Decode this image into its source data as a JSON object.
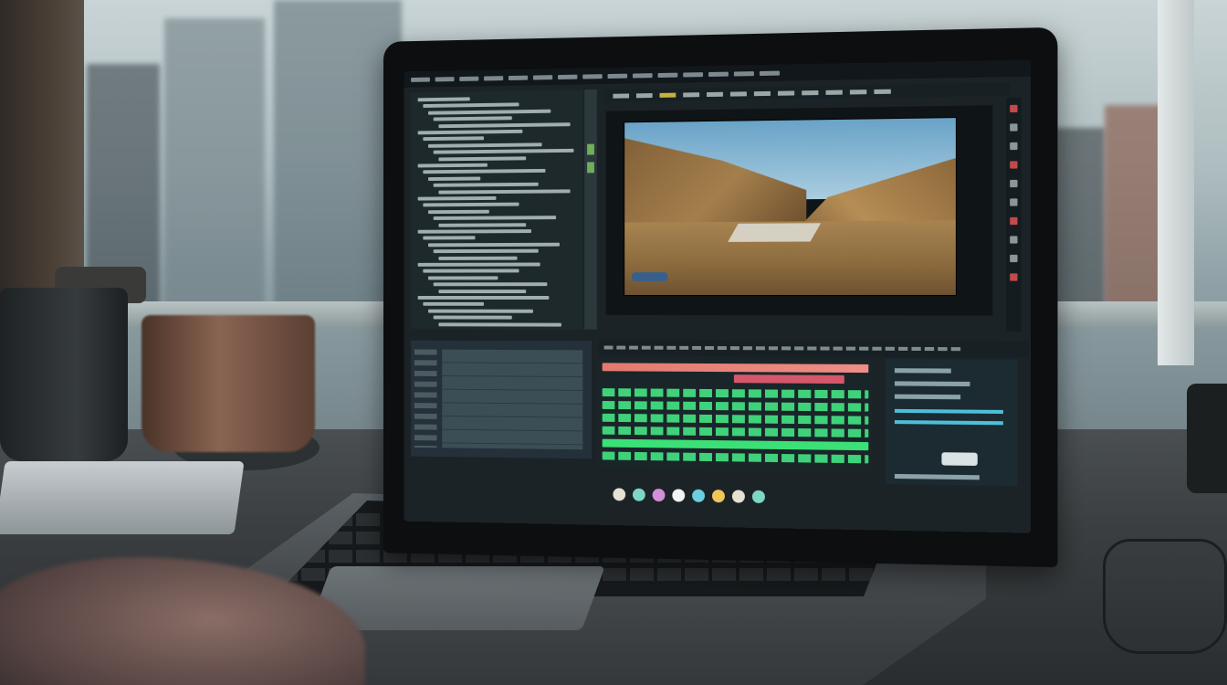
{
  "scene": {
    "description_tags": [
      "video-editing-software",
      "laptop",
      "window",
      "desk"
    ]
  },
  "screen": {
    "menu_items": [
      "",
      "",
      "",
      "",
      "",
      "",
      "",
      "",
      "",
      "",
      "",
      "",
      "",
      "",
      ""
    ],
    "viewer_tools": 12,
    "dock_icons": [
      "a",
      "b",
      "c",
      "d",
      "e",
      "f",
      "a",
      "b"
    ]
  },
  "colors": {
    "accent_green": "#3be077",
    "accent_pink": "#e47a6e",
    "accent_cyan": "#4cc0d8"
  }
}
